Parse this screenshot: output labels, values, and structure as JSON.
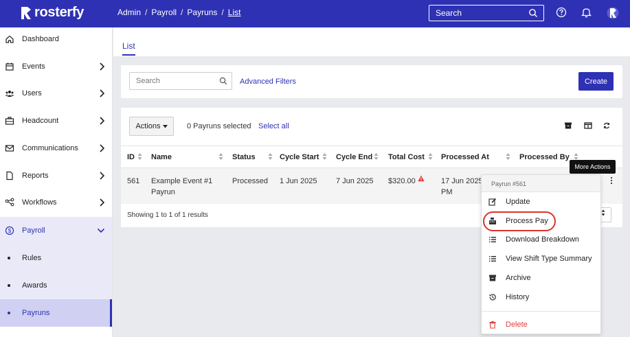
{
  "topbar": {
    "app_name": "rosterfy",
    "breadcrumbs": [
      "Admin",
      "Payroll",
      "Payruns",
      "List"
    ],
    "breadcrumb_sep": "/",
    "search_placeholder": "Search",
    "bg_color": "#2e31b3",
    "icons": [
      "help-icon",
      "bell-icon",
      "user-avatar-icon"
    ]
  },
  "sidebar": {
    "items": [
      {
        "label": "Dashboard",
        "icon": "home-icon",
        "has_chevron": false
      },
      {
        "label": "Events",
        "icon": "calendar-icon",
        "has_chevron": true
      },
      {
        "label": "Users",
        "icon": "users-icon",
        "has_chevron": true
      },
      {
        "label": "Headcount",
        "icon": "briefcase-icon",
        "has_chevron": true
      },
      {
        "label": "Communications",
        "icon": "envelope-icon",
        "has_chevron": true
      },
      {
        "label": "Reports",
        "icon": "document-icon",
        "has_chevron": true
      },
      {
        "label": "Workflows",
        "icon": "workflow-icon",
        "has_chevron": true
      },
      {
        "label": "Payroll",
        "icon": "dollar-icon",
        "has_chevron": true,
        "expanded": true
      }
    ],
    "payroll_sub": [
      "Rules",
      "Awards",
      "Payruns"
    ],
    "active_sub": "Payruns"
  },
  "tabs": {
    "active": "List"
  },
  "filters": {
    "search_placeholder": "Search",
    "advanced_filters": "Advanced Filters",
    "create_label": "Create"
  },
  "table_toolbar": {
    "actions_label": "Actions",
    "selected_text": "0 Payruns selected",
    "select_all": "Select all"
  },
  "table": {
    "columns": [
      "ID",
      "Name",
      "Status",
      "Cycle Start",
      "Cycle End",
      "Total Cost",
      "Processed At",
      "Processed By"
    ],
    "rows": [
      {
        "id": "561",
        "name_line1": "Example Event #1",
        "name_line2": "Payrun",
        "status": "Processed",
        "cycle_start": "1 Jun 2025",
        "cycle_end": "7 Jun 2025",
        "total_cost": "$320.00",
        "processed_at_line1": "17 Jun 2025",
        "processed_at_line2": "PM"
      }
    ],
    "footer": "Showing 1 to 1 of 1 results"
  },
  "tooltip": "More Actions",
  "context_menu": {
    "header": "Payrun #561",
    "items": [
      {
        "label": "Update",
        "icon": "edit-icon"
      },
      {
        "label": "Process Pay",
        "icon": "cash-register-icon"
      },
      {
        "label": "Download Breakdown",
        "icon": "list-icon"
      },
      {
        "label": "View Shift Type Summary",
        "icon": "list-icon"
      },
      {
        "label": "Archive",
        "icon": "archive-icon"
      },
      {
        "label": "History",
        "icon": "history-icon"
      },
      {
        "label": "Delete",
        "icon": "trash-icon"
      }
    ],
    "highlighted": "Process Pay",
    "danger_color": "#e33b3b"
  }
}
